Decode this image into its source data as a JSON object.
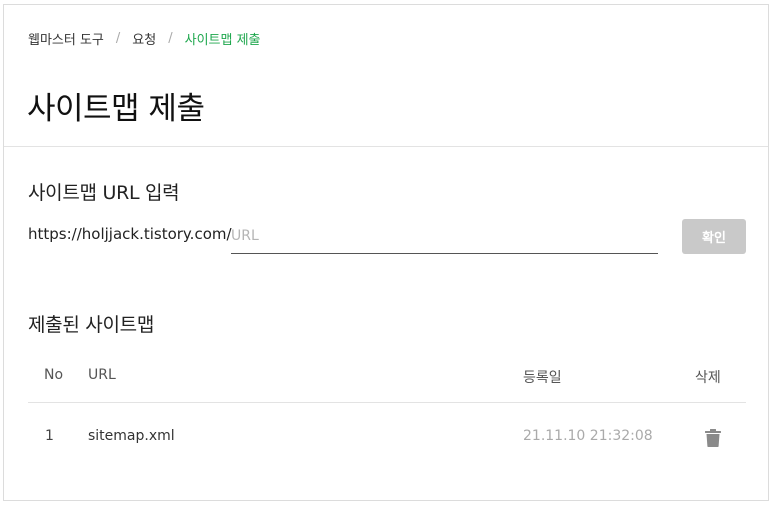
{
  "breadcrumb": {
    "items": [
      "웹마스터 도구",
      "요청",
      "사이트맵 제출"
    ],
    "separator": "/"
  },
  "page_title": "사이트맵 제출",
  "input_section": {
    "title": "사이트맵 URL 입력",
    "prefix": "https://holjjack.tistory.com/",
    "url_placeholder": "URL",
    "url_value": "",
    "confirm_label": "확인"
  },
  "submitted_section": {
    "title": "제출된 사이트맵",
    "columns": [
      "No",
      "URL",
      "등록일",
      "삭제"
    ],
    "rows": [
      {
        "no": "1",
        "url": "sitemap.xml",
        "date": "21.11.10 21:32:08",
        "delete_icon": "trash-icon"
      }
    ]
  },
  "colors": {
    "accent_green": "#1fa74e",
    "button_disabled": "#c9c9c9"
  }
}
